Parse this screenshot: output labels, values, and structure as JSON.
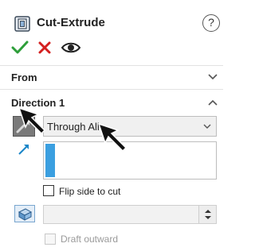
{
  "header": {
    "title": "Cut-Extrude",
    "help": "?",
    "feature_icon": "cut-extrude-icon",
    "ok_icon": "checkmark-icon",
    "cancel_icon": "close-icon",
    "preview_icon": "eye-icon"
  },
  "sections": {
    "from": {
      "label": "From",
      "expanded": false
    },
    "direction1": {
      "label": "Direction 1",
      "expanded": true
    }
  },
  "direction1": {
    "end_condition": "Through All",
    "flip_label": "Flip side to cut",
    "flip_checked": false,
    "draft_label": "Draft outward",
    "draft_enabled": false,
    "draft_value": ""
  },
  "colors": {
    "ok": "#2e9e3a",
    "cancel": "#d41f1f",
    "accent": "#3b9fe0"
  }
}
